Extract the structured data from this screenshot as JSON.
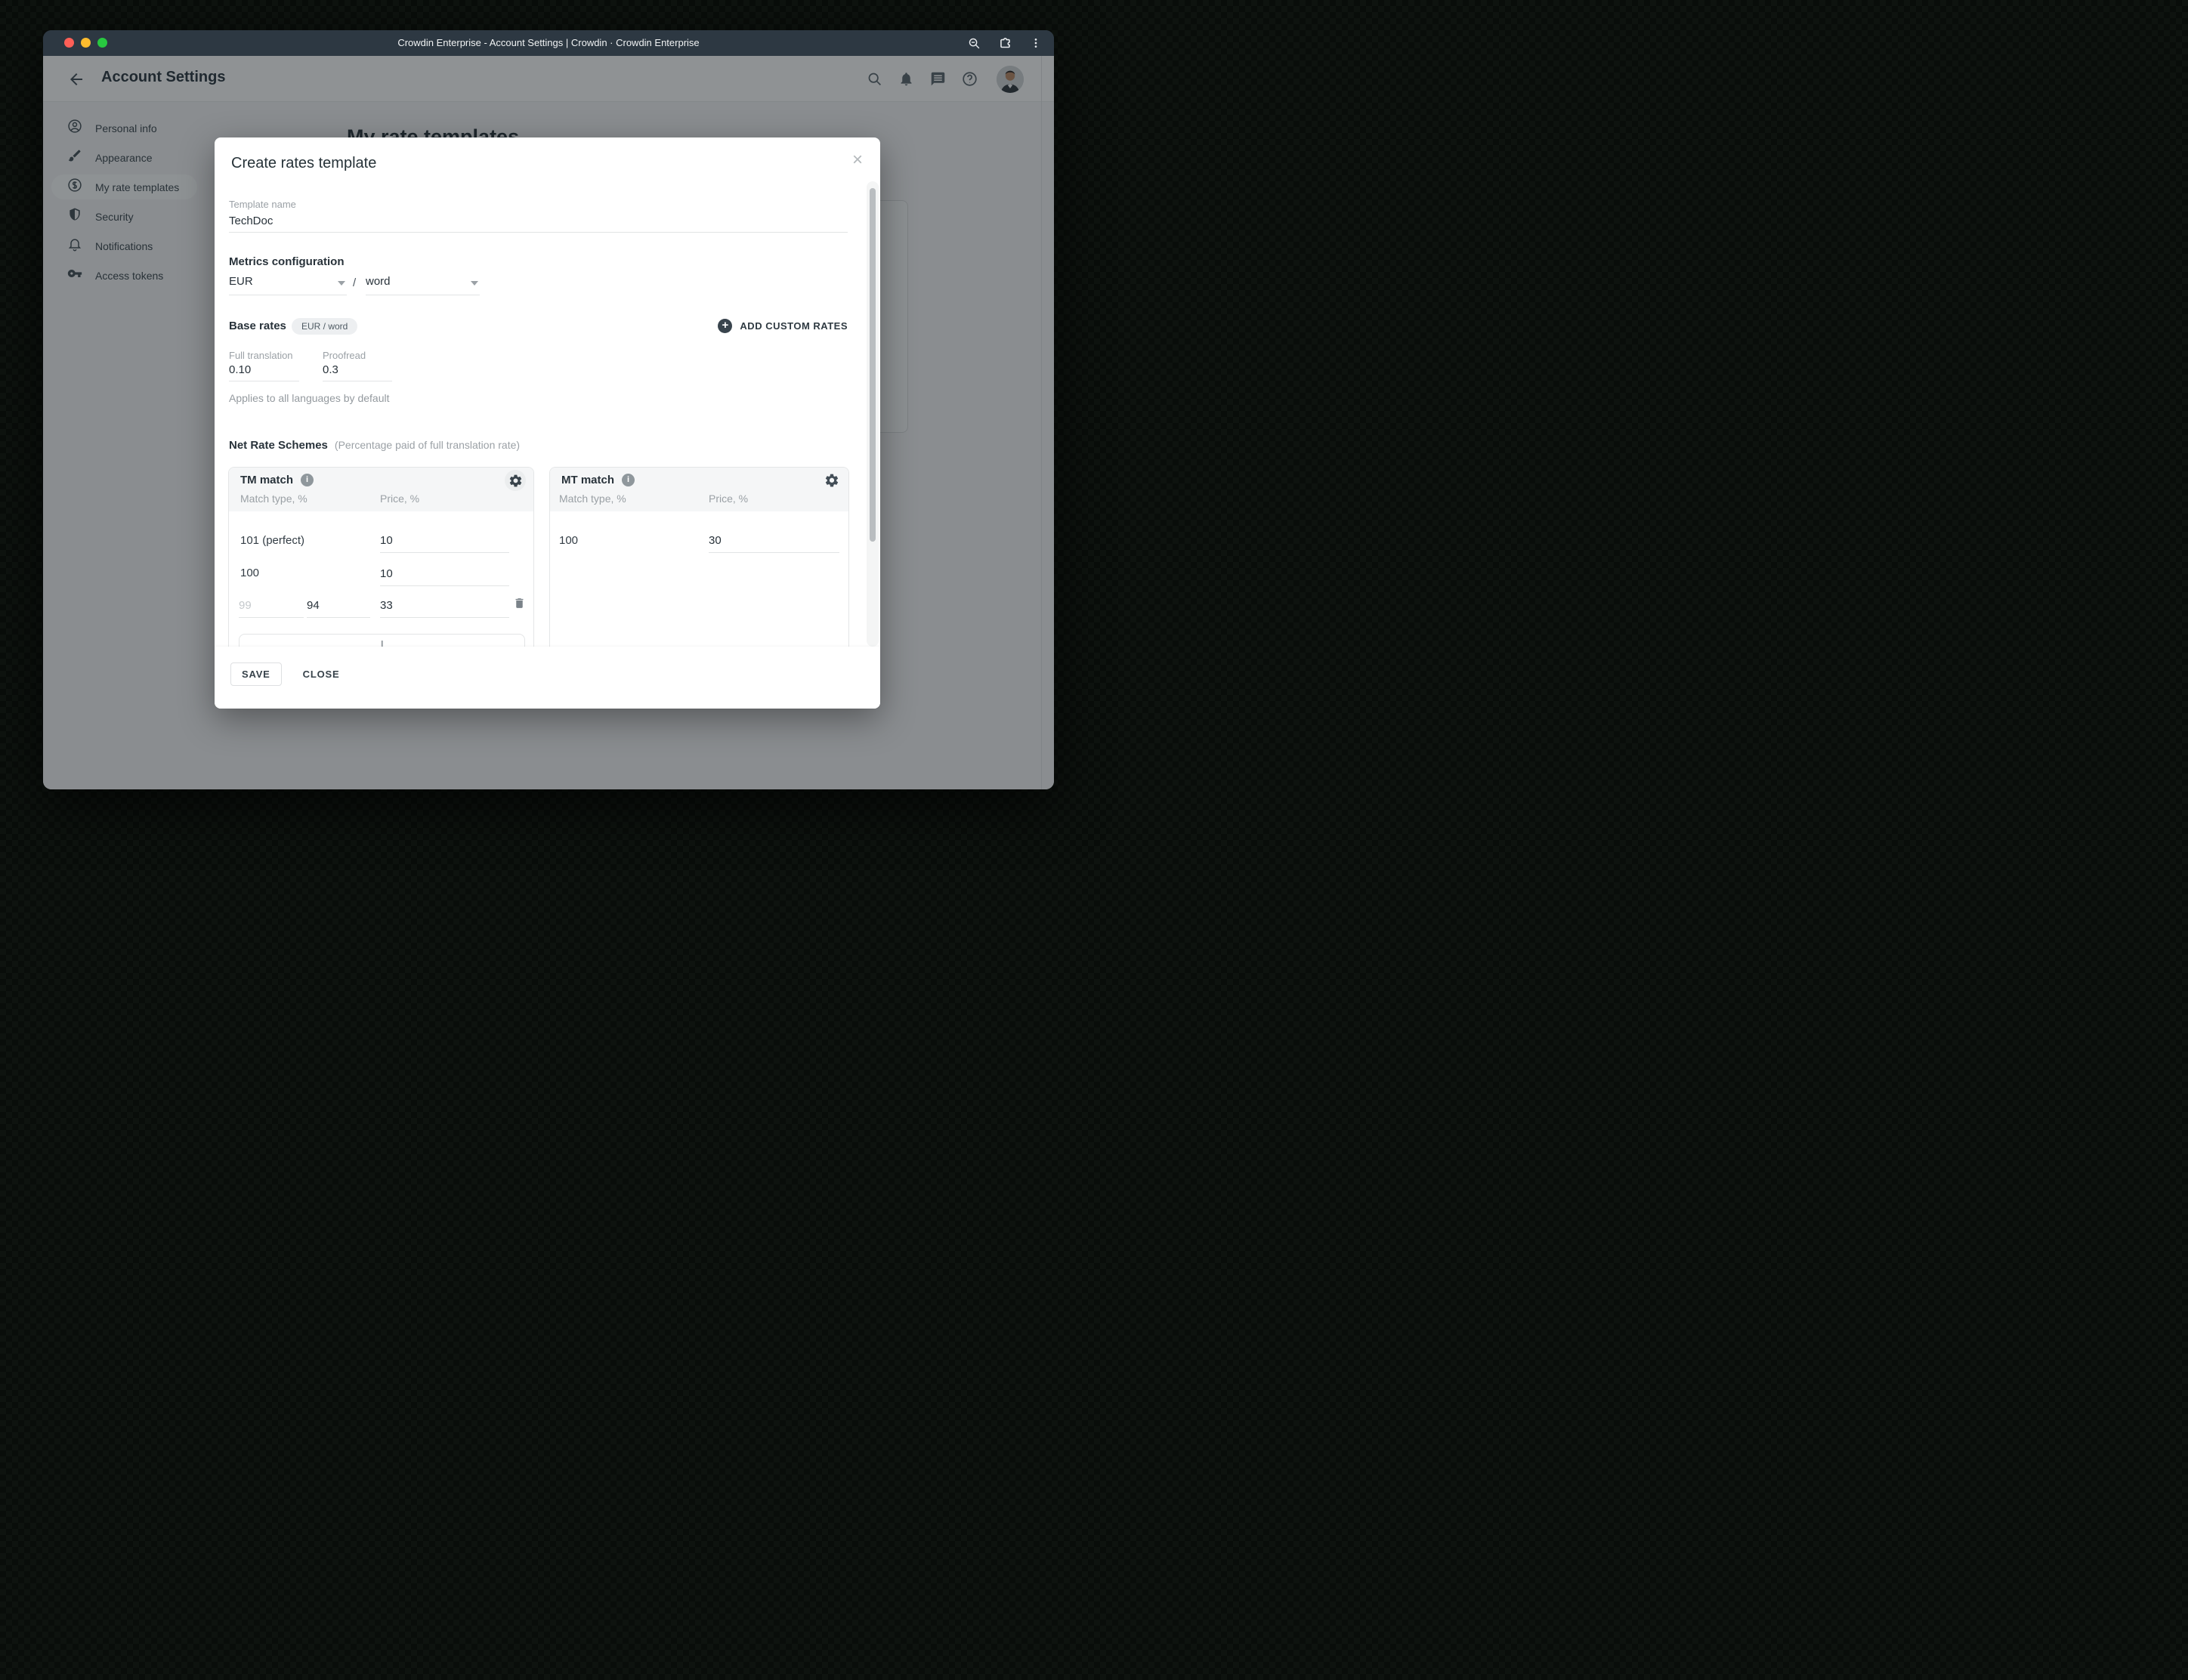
{
  "browser": {
    "title": "Crowdin Enterprise - Account Settings | Crowdin · Crowdin Enterprise"
  },
  "header": {
    "title": "Account Settings"
  },
  "sidebar": {
    "items": [
      {
        "label": "Personal info",
        "selected": false
      },
      {
        "label": "Appearance",
        "selected": false
      },
      {
        "label": "My rate templates",
        "selected": true
      },
      {
        "label": "Security",
        "selected": false
      },
      {
        "label": "Notifications",
        "selected": false
      },
      {
        "label": "Access tokens",
        "selected": false
      }
    ]
  },
  "background": {
    "page_title": "My rate templates"
  },
  "modal": {
    "title": "Create rates template",
    "close_icon": "×",
    "template_name": {
      "label": "Template name",
      "value": "TechDoc"
    },
    "metrics": {
      "heading": "Metrics configuration",
      "currency": "EUR",
      "separator": "/",
      "unit": "word"
    },
    "base_rates": {
      "heading": "Base rates",
      "chip": "EUR / word",
      "add_button": "ADD CUSTOM RATES",
      "add_plus": "+",
      "fields": [
        {
          "label": "Full translation",
          "value": "0.10"
        },
        {
          "label": "Proofread",
          "value": "0.3"
        }
      ],
      "note": "Applies to all languages by default"
    },
    "net_rate": {
      "heading": "Net Rate Schemes",
      "subtitle": "(Percentage paid of full translation rate)"
    },
    "tm": {
      "title": "TM match",
      "info": "i",
      "col_match": "Match type, %",
      "col_price": "Price, %",
      "rows": [
        {
          "match": "101 (perfect)",
          "price": "10"
        },
        {
          "match": "100",
          "price": "10"
        }
      ],
      "custom_row": {
        "from_placeholder": "99",
        "match_value": "94",
        "price": "33"
      }
    },
    "mt": {
      "title": "MT match",
      "info": "i",
      "col_match": "Match type, %",
      "col_price": "Price, %",
      "rows": [
        {
          "match": "100",
          "price": "30"
        }
      ]
    },
    "footer": {
      "save": "SAVE",
      "close": "CLOSE"
    }
  },
  "colors": {
    "titlebar": "#2d3842",
    "accent_dark": "#39444d",
    "dim_overlay": "rgba(16,22,27,0.46)",
    "traffic_red": "#ff5f57",
    "traffic_yellow": "#febc2e",
    "traffic_green": "#28c840"
  }
}
